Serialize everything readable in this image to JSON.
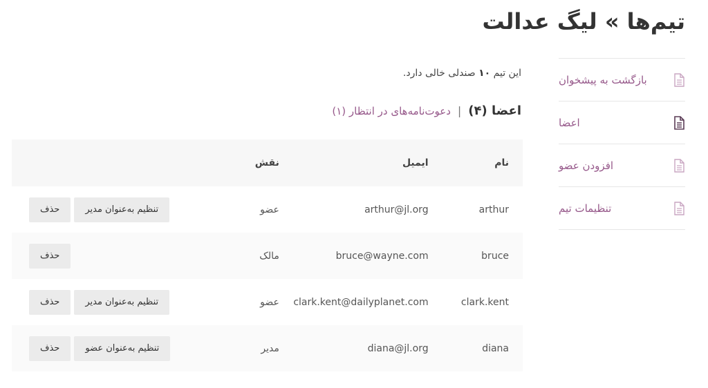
{
  "page": {
    "title": "تیم‌ها » لیگ عدالت"
  },
  "sidebar": {
    "items": [
      {
        "label": "بازگشت به پیشخوان",
        "icon": "document-icon",
        "active": false
      },
      {
        "label": "اعضا",
        "icon": "document-icon",
        "active": true
      },
      {
        "label": "افزودن عضو",
        "icon": "document-icon",
        "active": false
      },
      {
        "label": "تنظیمات تیم",
        "icon": "document-icon",
        "active": false
      }
    ]
  },
  "main": {
    "seats_notice_prefix": "این تیم",
    "seats_count": "۱۰",
    "seats_notice_suffix": "صندلی خالی دارد.",
    "subnav": {
      "members_label": "اعضا (۴)",
      "separator": "|",
      "invitations_label": "دعوت‌نامه‌های در انتظار (۱)"
    },
    "table": {
      "headers": {
        "name": "نام",
        "email": "ایمیل",
        "role": "نقش",
        "actions": ""
      },
      "rows": [
        {
          "name": "arthur",
          "email": "arthur@jl.org",
          "role": "عضو",
          "set_label": "تنظیم به‌عنوان مدیر",
          "remove_label": "حذف"
        },
        {
          "name": "bruce",
          "email": "bruce@wayne.com",
          "role": "مالک",
          "set_label": "",
          "remove_label": "حذف"
        },
        {
          "name": "clark.kent",
          "email": "clark.kent@dailyplanet.com",
          "role": "عضو",
          "set_label": "تنظیم به‌عنوان مدیر",
          "remove_label": "حذف"
        },
        {
          "name": "diana",
          "email": "diana@jl.org",
          "role": "مدیر",
          "set_label": "تنظیم به‌عنوان عضو",
          "remove_label": "حذف"
        }
      ]
    }
  },
  "colors": {
    "accent": "#96588a",
    "header_bg": "#f7f7f7",
    "button_bg": "#ebebeb"
  }
}
